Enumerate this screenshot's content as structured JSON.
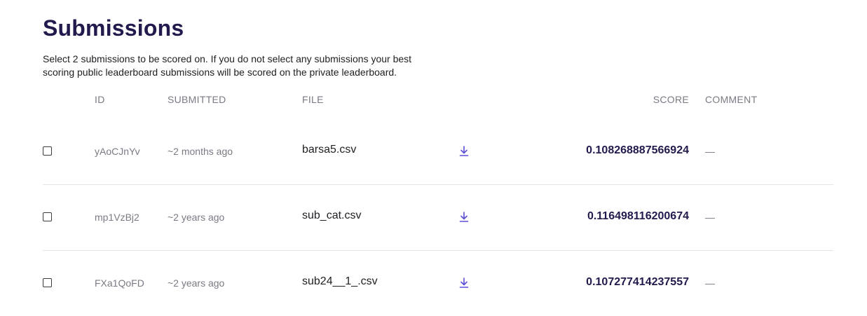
{
  "page": {
    "title": "Submissions",
    "description": "Select 2 submissions to be scored on. If you do not select any submissions your best scoring public leaderboard submissions will be scored on the private leaderboard."
  },
  "table": {
    "headers": {
      "id": "ID",
      "submitted": "SUBMITTED",
      "file": "FILE",
      "score": "SCORE",
      "comment": "COMMENT"
    },
    "rows": [
      {
        "id": "yAoCJnYv",
        "submitted": "~2 months ago",
        "file": "barsa5.csv",
        "score": "0.108268887566924",
        "comment": "—"
      },
      {
        "id": "mp1VzBj2",
        "submitted": "~2 years ago",
        "file": "sub_cat.csv",
        "score": "0.116498116200674",
        "comment": "—"
      },
      {
        "id": "FXa1QoFD",
        "submitted": "~2 years ago",
        "file": "sub24__1_.csv",
        "score": "0.107277414237557",
        "comment": "—"
      }
    ]
  },
  "colors": {
    "title": "#221a4d",
    "accent": "#5b4fd6",
    "muted": "#7a7a85"
  },
  "icons": {
    "download": "download-icon"
  }
}
